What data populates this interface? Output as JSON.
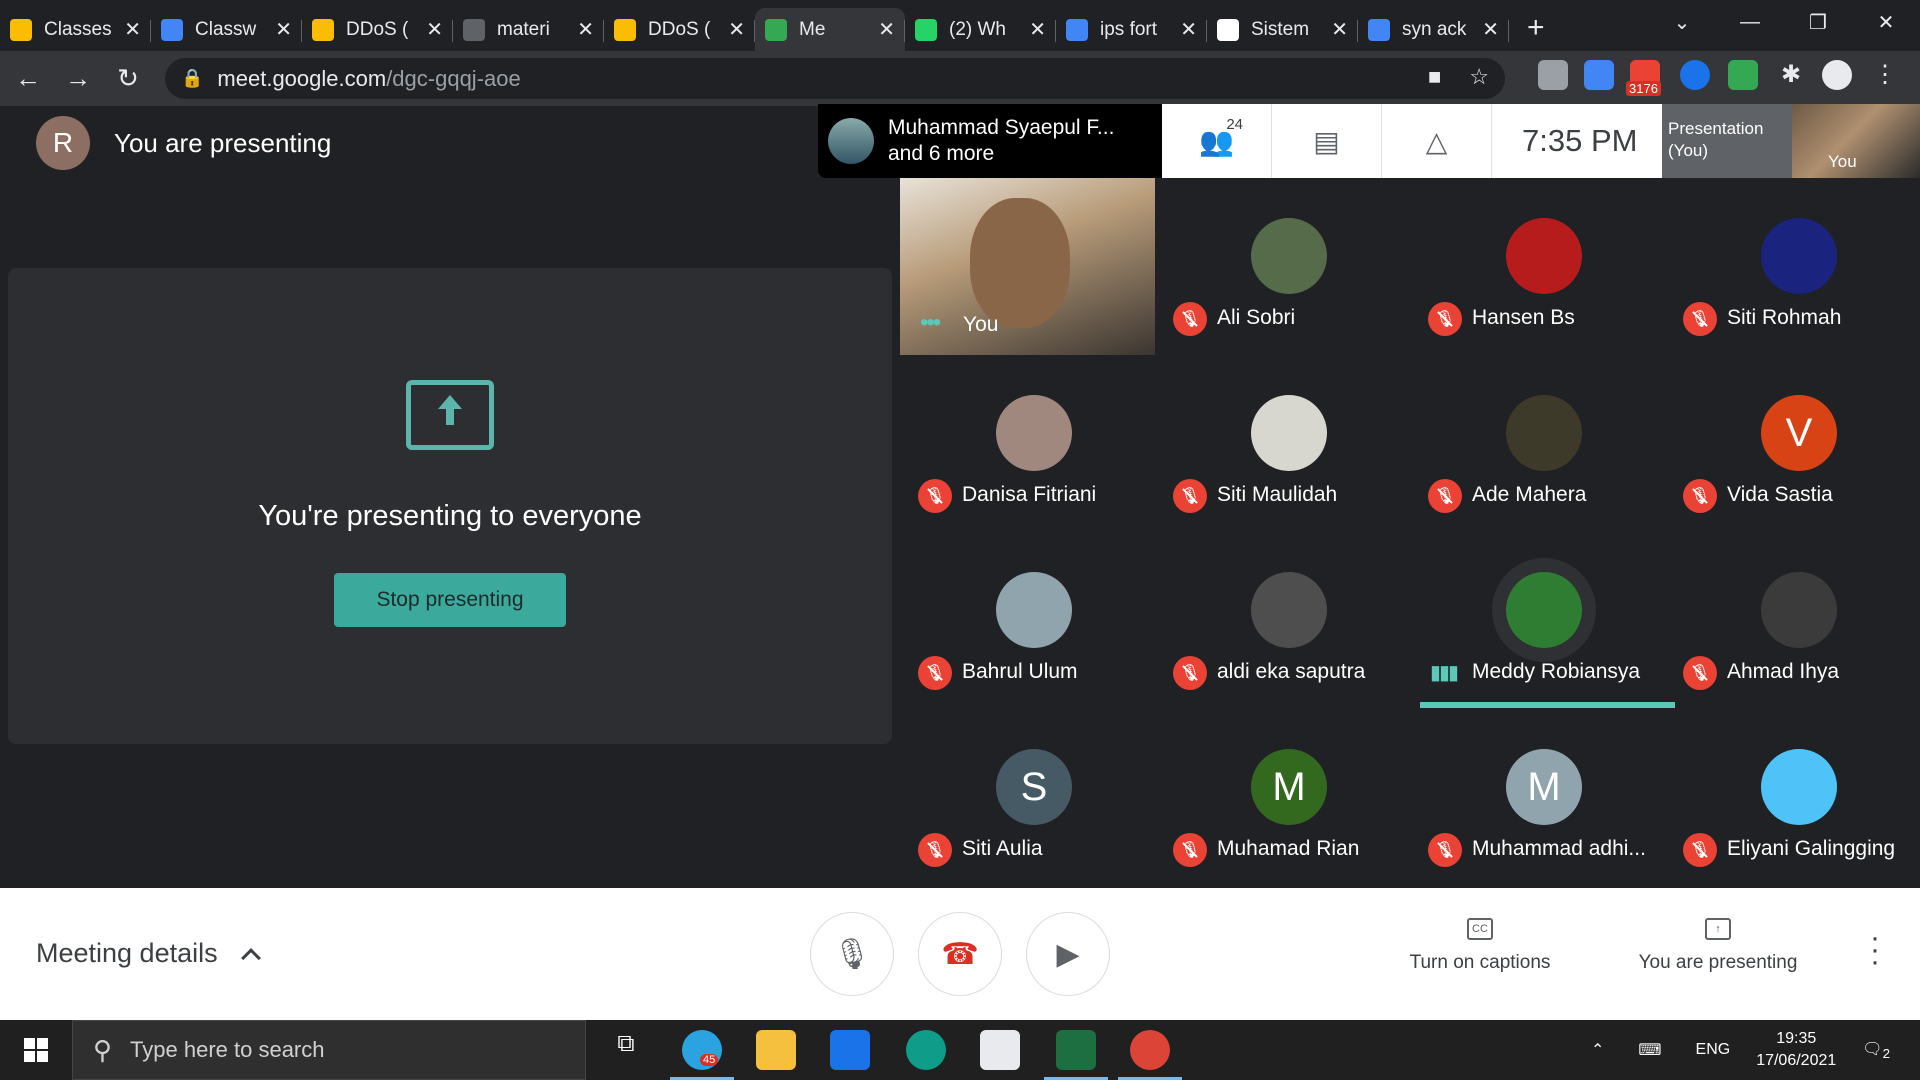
{
  "browser": {
    "tabs": [
      {
        "label": "Classes",
        "color": "#fbbc04"
      },
      {
        "label": "Classw",
        "color": "#4285f4"
      },
      {
        "label": "DDoS (",
        "color": "#fbbc04"
      },
      {
        "label": "materi",
        "color": "#5f6368"
      },
      {
        "label": "DDoS (",
        "color": "#fbbc04"
      },
      {
        "label": "Me",
        "color": "#34a853",
        "active": true
      },
      {
        "label": "(2) Wh",
        "color": "#25d366"
      },
      {
        "label": "ips fort",
        "color": "#4285f4"
      },
      {
        "label": "Sistem",
        "color": "#ffffff"
      },
      {
        "label": "syn ack",
        "color": "#4285f4"
      }
    ],
    "new_tab": "+",
    "url_host": "meet.google.com",
    "url_path": "/dgc-gqqj-aoe",
    "gmail_badge": "3176"
  },
  "meet": {
    "presenter_initial": "R",
    "presenter_title": "You are presenting",
    "present_message": "You're presenting to everyone",
    "stop_button": "Stop presenting",
    "top_info_line1": "Muhammad Syaepul F...",
    "top_info_line2": "and 6 more",
    "participant_count": "24",
    "clock": "7:35 PM",
    "presentation_thumb": "Presentation (You)",
    "you_thumb": "You",
    "self_tile_name": "You",
    "participants": [
      {
        "name": "Ali Sobri",
        "bg": "#556b4a"
      },
      {
        "name": "Hansen Bs",
        "bg": "#b71c1c"
      },
      {
        "name": "Siti Rohmah",
        "bg": "#1a237e"
      },
      {
        "name": "Danisa Fitriani",
        "bg": "#a1887f"
      },
      {
        "name": "Siti Maulidah",
        "bg": "#d7d7d0"
      },
      {
        "name": "Ade Mahera",
        "bg": "#3e3a2a"
      },
      {
        "name": "Vida Sastia",
        "initial": "V",
        "bg": "#d84315"
      },
      {
        "name": "Bahrul Ulum",
        "bg": "#90a4ae"
      },
      {
        "name": "aldi eka saputra",
        "bg": "#4e4e4e"
      },
      {
        "name": "Meddy Robiansya",
        "bg": "#2e7d32",
        "speaking": true
      },
      {
        "name": "Ahmad Ihya",
        "bg": "#3b3b3b"
      },
      {
        "name": "Siti Aulia",
        "initial": "S",
        "bg": "#455a64"
      },
      {
        "name": "Muhamad Rian",
        "initial": "M",
        "bg": "#33691e"
      },
      {
        "name": "Muhammad adhi...",
        "initial": "M",
        "bg": "#90a4ae"
      },
      {
        "name": "Eliyani Galingging",
        "bg": "#4fc3f7"
      }
    ],
    "meeting_details": "Meeting details",
    "captions_label": "Turn on captions",
    "presenting_label": "You are presenting"
  },
  "taskbar": {
    "search_placeholder": "Type here to search",
    "telegram_badge": "45",
    "lang": "ENG",
    "time": "19:35",
    "date": "17/06/2021",
    "notif_count": "2"
  }
}
